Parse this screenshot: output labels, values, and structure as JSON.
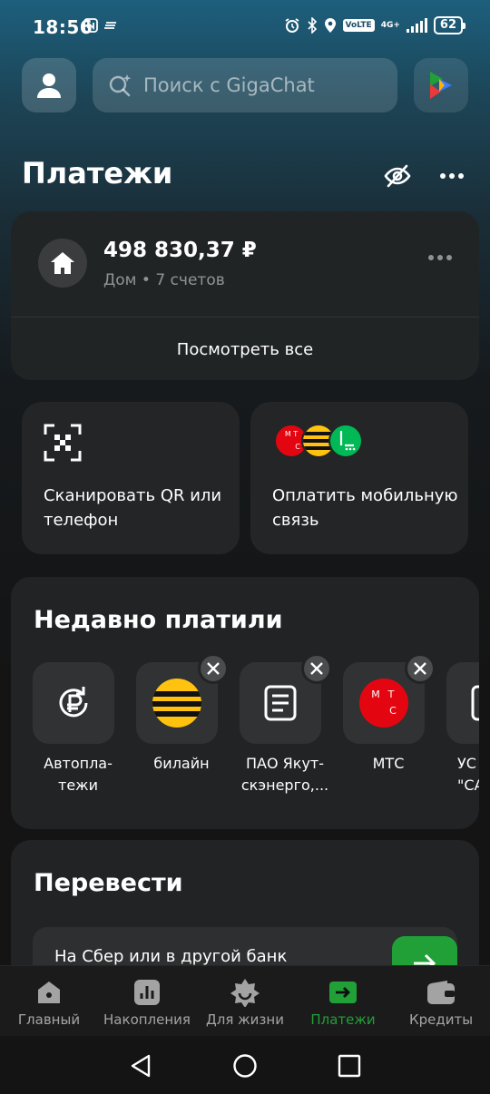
{
  "status_bar": {
    "time": "18:56",
    "volte": "VoLTE",
    "network": "4G+",
    "battery": "62"
  },
  "top_bar": {
    "search_placeholder": "Поиск с GigaChat"
  },
  "header": {
    "title": "Платежи"
  },
  "account": {
    "amount": "498 830,37 ₽",
    "subtitle": "Дом • 7 счетов",
    "view_all": "Посмотреть все"
  },
  "actions": [
    {
      "label": "Сканировать QR или телефон",
      "icon": "qr-scan-icon"
    },
    {
      "label": "Оплатить мобильную связь",
      "icon": "mobile-operators-icon"
    }
  ],
  "operator_logos": {
    "mts": "М Т С"
  },
  "recent": {
    "title": "Недавно платили",
    "items": [
      {
        "label": "Автопла-\nтежи",
        "icon": "autopay-ruble-icon",
        "removable": false
      },
      {
        "label": "билайн",
        "icon": "beeline-logo",
        "removable": true
      },
      {
        "label": "ПАО Якут-\nскэнерго,...",
        "icon": "document-icon",
        "removable": true
      },
      {
        "label": "МТС",
        "icon": "mts-logo",
        "removable": true
      },
      {
        "label": "УС\n\"СА",
        "icon": "document-icon",
        "removable": false
      }
    ]
  },
  "transfer": {
    "title": "Перевести",
    "row_text": "На Сбер или в другой банк"
  },
  "bottom_nav": [
    {
      "label": "Главный",
      "icon": "home-icon",
      "active": false
    },
    {
      "label": "Накопления",
      "icon": "chart-icon",
      "active": false
    },
    {
      "label": "Для жизни",
      "icon": "smile-icon",
      "active": false
    },
    {
      "label": "Платежи",
      "icon": "payments-arrow-icon",
      "active": true
    },
    {
      "label": "Кредиты",
      "icon": "wallet-icon",
      "active": false
    }
  ],
  "colors": {
    "accent": "#21a038",
    "card": "#212324",
    "mts_red": "#e30611",
    "beeline_yellow": "#ffc20e",
    "megafon_green": "#00b956"
  }
}
